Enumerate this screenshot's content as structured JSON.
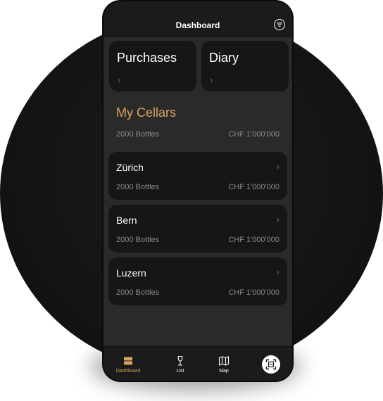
{
  "header": {
    "title": "Dashboard",
    "filter_icon": "filter-icon"
  },
  "quick_tiles": [
    {
      "label": "Purchases",
      "chevron": "›"
    },
    {
      "label": "Diary",
      "chevron": "›"
    }
  ],
  "cellars": {
    "title": "My Cellars",
    "total_bottles": "2000 Bottles",
    "total_value": "CHF 1'000'000",
    "items": [
      {
        "name": "Zürich",
        "bottles": "2000 Bottles",
        "value": "CHF 1'000'000",
        "chevron": "›"
      },
      {
        "name": "Bern",
        "bottles": "2000 Bottles",
        "value": "CHF 1'000'000",
        "chevron": "›"
      },
      {
        "name": "Luzern",
        "bottles": "2000 Bottles",
        "value": "CHF 1'000'000",
        "chevron": "›"
      }
    ]
  },
  "tabbar": {
    "tabs": [
      {
        "label": "Dashboard",
        "icon": "dashboard-icon",
        "active": true
      },
      {
        "label": "List",
        "icon": "wine-glass-icon",
        "active": false
      },
      {
        "label": "Map",
        "icon": "map-icon",
        "active": false
      }
    ],
    "scan_icon": "scan-icon"
  },
  "colors": {
    "accent": "#d9a55e",
    "screen_bg": "#2a2a2a",
    "card_bg": "#161616",
    "bar_bg": "#1b1b1b",
    "muted_text": "#8a8a8a"
  }
}
